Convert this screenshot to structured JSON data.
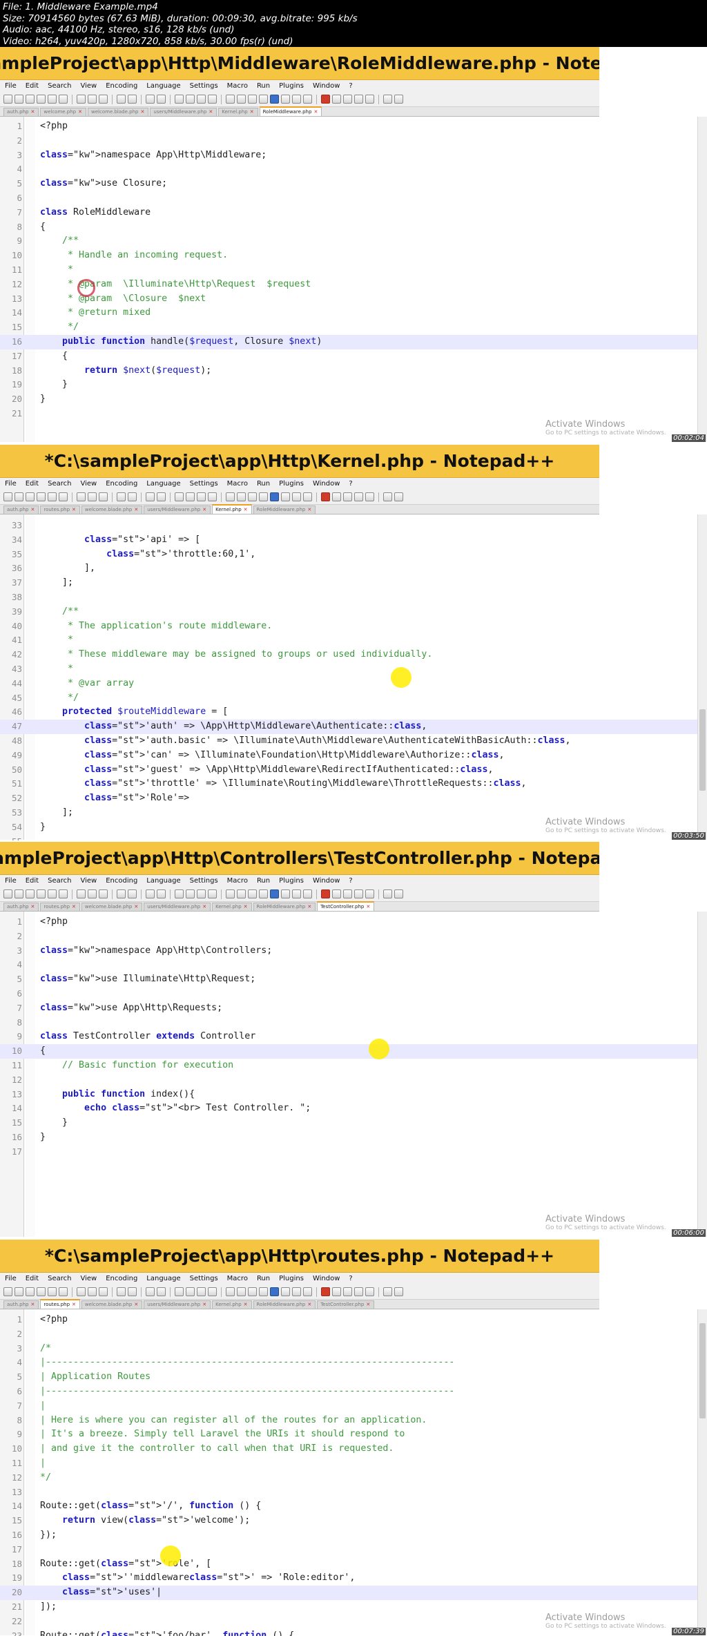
{
  "info": [
    "File: 1. Middleware Example.mp4",
    "Size: 70914560 bytes (67.63 MiB), duration: 00:09:30, avg.bitrate: 995 kb/s",
    "Audio: aac, 44100 Hz, stereo, s16, 128 kb/s (und)",
    "Video: h264, yuv420p, 1280x720, 858 kb/s, 30.00 fps(r) (und)"
  ],
  "menu": [
    "File",
    "Edit",
    "Search",
    "View",
    "Encoding",
    "Language",
    "Settings",
    "Macro",
    "Run",
    "Plugins",
    "Window",
    "?"
  ],
  "watermark": {
    "title": "Activate Windows",
    "sub": "Go to PC settings to activate Windows."
  },
  "frames": [
    {
      "title": "C:\\sampleProject\\app\\Http\\Middleware\\RoleMiddleware.php - Notepa...",
      "timestamp": "00:02:04",
      "tabs": [
        "auth.php",
        "welcome.php",
        "welcome.blade.php",
        "users/Middleware.php",
        "Kernel.php",
        "RoleMiddleware.php"
      ],
      "active_tab": 5,
      "lines": [
        {
          "n": "1",
          "t": "<?php"
        },
        {
          "n": "2",
          "t": ""
        },
        {
          "n": "3",
          "t": "namespace App\\Http\\Middleware;"
        },
        {
          "n": "4",
          "t": ""
        },
        {
          "n": "5",
          "t": "use Closure;"
        },
        {
          "n": "6",
          "t": ""
        },
        {
          "n": "7",
          "t": "class RoleMiddleware"
        },
        {
          "n": "8",
          "t": "{"
        },
        {
          "n": "9",
          "t": "    /**"
        },
        {
          "n": "10",
          "t": "     * Handle an incoming request."
        },
        {
          "n": "11",
          "t": "     *"
        },
        {
          "n": "12",
          "t": "     * @param  \\Illuminate\\Http\\Request  $request"
        },
        {
          "n": "13",
          "t": "     * @param  \\Closure  $next"
        },
        {
          "n": "14",
          "t": "     * @return mixed"
        },
        {
          "n": "15",
          "t": "     */"
        },
        {
          "n": "16",
          "t": "    public function handle($request, Closure $next)"
        },
        {
          "n": "17",
          "t": "    {"
        },
        {
          "n": "18",
          "t": "        return $next($request);"
        },
        {
          "n": "19",
          "t": "    }"
        },
        {
          "n": "20",
          "t": "}"
        },
        {
          "n": "21",
          "t": ""
        }
      ]
    },
    {
      "title": "*C:\\sampleProject\\app\\Http\\Kernel.php - Notepad++",
      "timestamp": "00:03:50",
      "tabs": [
        "auth.php",
        "routes.php",
        "welcome.blade.php",
        "users/Middleware.php",
        "Kernel.php",
        "RoleMiddleware.php"
      ],
      "active_tab": 4,
      "lines": [
        {
          "n": "33",
          "t": ""
        },
        {
          "n": "34",
          "t": "        'api' => ["
        },
        {
          "n": "35",
          "t": "            'throttle:60,1',"
        },
        {
          "n": "36",
          "t": "        ],"
        },
        {
          "n": "37",
          "t": "    ];"
        },
        {
          "n": "38",
          "t": ""
        },
        {
          "n": "39",
          "t": "    /**"
        },
        {
          "n": "40",
          "t": "     * The application's route middleware."
        },
        {
          "n": "41",
          "t": "     *"
        },
        {
          "n": "42",
          "t": "     * These middleware may be assigned to groups or used individually."
        },
        {
          "n": "43",
          "t": "     *"
        },
        {
          "n": "44",
          "t": "     * @var array"
        },
        {
          "n": "45",
          "t": "     */"
        },
        {
          "n": "46",
          "t": "    protected $routeMiddleware = ["
        },
        {
          "n": "47",
          "t": "        'auth' => \\App\\Http\\Middleware\\Authenticate::class,"
        },
        {
          "n": "48",
          "t": "        'auth.basic' => \\Illuminate\\Auth\\Middleware\\AuthenticateWithBasicAuth::class,"
        },
        {
          "n": "49",
          "t": "        'can' => \\Illuminate\\Foundation\\Http\\Middleware\\Authorize::class,"
        },
        {
          "n": "50",
          "t": "        'guest' => \\App\\Http\\Middleware\\RedirectIfAuthenticated::class,"
        },
        {
          "n": "51",
          "t": "        'throttle' => \\Illuminate\\Routing\\Middleware\\ThrottleRequests::class,"
        },
        {
          "n": "52",
          "t": "        'Role'=>"
        },
        {
          "n": "53",
          "t": "    ];"
        },
        {
          "n": "54",
          "t": "}"
        },
        {
          "n": "55",
          "t": ""
        }
      ]
    },
    {
      "title": "C:\\sampleProject\\app\\Http\\Controllers\\TestController.php - Notepad++",
      "timestamp": "00:06:00",
      "tabs": [
        "auth.php",
        "routes.php",
        "welcome.blade.php",
        "users/Middleware.php",
        "Kernel.php",
        "RoleMiddleware.php",
        "TestController.php"
      ],
      "active_tab": 6,
      "lines": [
        {
          "n": "1",
          "t": "<?php"
        },
        {
          "n": "2",
          "t": ""
        },
        {
          "n": "3",
          "t": "namespace App\\Http\\Controllers;"
        },
        {
          "n": "4",
          "t": ""
        },
        {
          "n": "5",
          "t": "use Illuminate\\Http\\Request;"
        },
        {
          "n": "6",
          "t": ""
        },
        {
          "n": "7",
          "t": "use App\\Http\\Requests;"
        },
        {
          "n": "8",
          "t": ""
        },
        {
          "n": "9",
          "t": "class TestController extends Controller"
        },
        {
          "n": "10",
          "t": "{"
        },
        {
          "n": "11",
          "t": "    // Basic function for execution"
        },
        {
          "n": "12",
          "t": ""
        },
        {
          "n": "13",
          "t": "    public function index(){"
        },
        {
          "n": "14",
          "t": "        echo \"<br> Test Controller. \";"
        },
        {
          "n": "15",
          "t": "    }"
        },
        {
          "n": "16",
          "t": "}"
        },
        {
          "n": "17",
          "t": ""
        }
      ]
    },
    {
      "title": "*C:\\sampleProject\\app\\Http\\routes.php - Notepad++",
      "timestamp": "00:07:39",
      "tabs": [
        "auth.php",
        "routes.php",
        "welcome.blade.php",
        "users/Middleware.php",
        "Kernel.php",
        "RoleMiddleware.php",
        "TestController.php"
      ],
      "active_tab": 1,
      "lines": [
        {
          "n": "1",
          "t": "<?php"
        },
        {
          "n": "2",
          "t": ""
        },
        {
          "n": "3",
          "t": "/*"
        },
        {
          "n": "4",
          "t": "|--------------------------------------------------------------------------"
        },
        {
          "n": "5",
          "t": "| Application Routes"
        },
        {
          "n": "6",
          "t": "|--------------------------------------------------------------------------"
        },
        {
          "n": "7",
          "t": "|"
        },
        {
          "n": "8",
          "t": "| Here is where you can register all of the routes for an application."
        },
        {
          "n": "9",
          "t": "| It's a breeze. Simply tell Laravel the URIs it should respond to"
        },
        {
          "n": "10",
          "t": "| and give it the controller to call when that URI is requested."
        },
        {
          "n": "11",
          "t": "|"
        },
        {
          "n": "12",
          "t": "*/"
        },
        {
          "n": "13",
          "t": ""
        },
        {
          "n": "14",
          "t": "Route::get('/', function () {"
        },
        {
          "n": "15",
          "t": "    return view('welcome');"
        },
        {
          "n": "16",
          "t": "});"
        },
        {
          "n": "17",
          "t": ""
        },
        {
          "n": "18",
          "t": "Route::get('role', ["
        },
        {
          "n": "19",
          "t": "    ''middleware' => 'Role:editor',"
        },
        {
          "n": "20",
          "t": "    'uses'|"
        },
        {
          "n": "21",
          "t": "]);"
        },
        {
          "n": "22",
          "t": ""
        },
        {
          "n": "23",
          "t": "Route::get('foo/bar', function () {"
        }
      ]
    }
  ]
}
